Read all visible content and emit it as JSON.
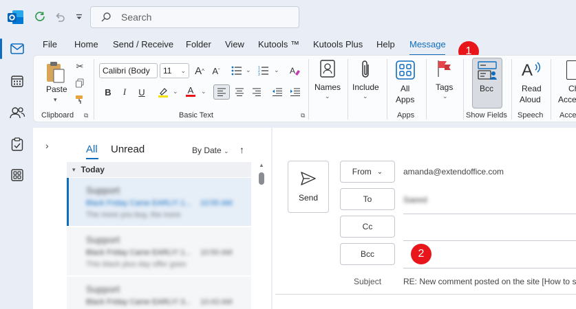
{
  "titlebar": {
    "search_placeholder": "Search",
    "icons": [
      "outlook-logo",
      "sync-icon",
      "undo-icon",
      "customize-dropdown-icon",
      "search-icon"
    ]
  },
  "rail": {
    "items": [
      "mail-icon",
      "calendar-icon",
      "people-icon",
      "tasks-icon",
      "apps-icon"
    ],
    "active": "mail-icon"
  },
  "menu": {
    "tabs": [
      "File",
      "Home",
      "Send / Receive",
      "Folder",
      "View",
      "Kutools ™",
      "Kutools Plus",
      "Help",
      "Message"
    ],
    "active": "Message"
  },
  "ribbon": {
    "clipboard": {
      "paste_label": "Paste",
      "group_label": "Clipboard"
    },
    "basic_text": {
      "font_name": "Calibri (Body",
      "font_size": "11",
      "group_label": "Basic Text",
      "grow_label": "A",
      "shrink_label": "A",
      "bold": "B",
      "italic": "I",
      "underline": "U",
      "color_a": "A"
    },
    "names": {
      "label": "Names"
    },
    "include": {
      "label": "Include"
    },
    "apps": {
      "label_line1": "All",
      "label_line2": "Apps",
      "group_label": "Apps"
    },
    "tags": {
      "label": "Tags"
    },
    "show_fields": {
      "bcc_label": "Bcc",
      "group_label": "Show Fields"
    },
    "speech": {
      "read_line1": "Read",
      "read_line2": "Aloud",
      "group_label": "Speech"
    },
    "accessibility": {
      "label_line1": "Ch",
      "label_line2": "Acce",
      "group_label": "Acce"
    }
  },
  "badges": {
    "one": "1",
    "two": "2"
  },
  "list": {
    "tab_all": "All",
    "tab_unread": "Unread",
    "sort_label": "By Date",
    "sort_arrow": "↑",
    "group_today": "Today",
    "items": [
      {
        "from": "Support",
        "subject": "Black Friday Came EARLY! 1...",
        "time": "10:55 AM",
        "preview": "The more you buy, the more"
      },
      {
        "from": "Support",
        "subject": "Black Friday Came EARLY! 1...",
        "time": "10:50 AM",
        "preview": "This black plus day offer goes"
      },
      {
        "from": "Support",
        "subject": "Black Friday Came EARLY! 3...",
        "time": "10:43 AM",
        "preview": ""
      }
    ]
  },
  "compose": {
    "send_label": "Send",
    "from_label": "From",
    "from_value": "amanda@extendoffice.com",
    "to_label": "To",
    "to_value": "Saeed",
    "cc_label": "Cc",
    "bcc_label": "Bcc",
    "subject_label": "Subject",
    "subject_value": "RE: New comment posted on the site [How to s"
  }
}
